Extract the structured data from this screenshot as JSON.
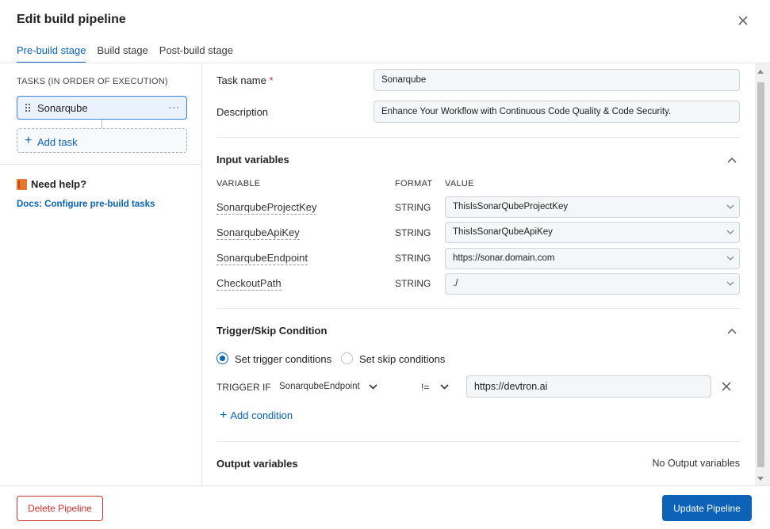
{
  "modal": {
    "title": "Edit build pipeline"
  },
  "tabs": [
    {
      "label": "Pre-build stage",
      "active": true
    },
    {
      "label": "Build stage",
      "active": false
    },
    {
      "label": "Post-build stage",
      "active": false
    }
  ],
  "sidebar": {
    "heading": "TASKS (IN ORDER OF EXECUTION)",
    "tasks": [
      {
        "name": "Sonarqube"
      }
    ],
    "more_glyph": "···",
    "add_task_label": "Add task",
    "help_title": "Need help?",
    "docs_link": "Docs: Configure pre-build tasks"
  },
  "task": {
    "name_label": "Task name",
    "required_mark": "*",
    "name_value": "Sonarqube",
    "description_label": "Description",
    "description_value": "Enhance Your Workflow with Continuous Code Quality & Code Security."
  },
  "input_variables": {
    "title": "Input variables",
    "headers": {
      "variable": "VARIABLE",
      "format": "FORMAT",
      "value": "VALUE"
    },
    "rows": [
      {
        "name": "SonarqubeProjectKey",
        "format": "STRING",
        "value": "ThisIsSonarQubeProjectKey"
      },
      {
        "name": "SonarqubeApiKey",
        "format": "STRING",
        "value": "ThisIsSonarQubeApiKey"
      },
      {
        "name": "SonarqubeEndpoint",
        "format": "STRING",
        "value": "https://sonar.domain.com"
      },
      {
        "name": "CheckoutPath",
        "format": "STRING",
        "value": "./"
      }
    ]
  },
  "condition": {
    "title": "Trigger/Skip Condition",
    "options": [
      {
        "label": "Set trigger conditions",
        "selected": true
      },
      {
        "label": "Set skip conditions",
        "selected": false
      }
    ],
    "trigger_label": "TRIGGER IF",
    "variable": "SonarqubeEndpoint",
    "operator": "!=",
    "value": "https://devtron.ai",
    "add_condition_label": "Add condition"
  },
  "output_variables": {
    "title": "Output variables",
    "empty_text": "No Output variables"
  },
  "footer": {
    "delete_label": "Delete Pipeline",
    "update_label": "Update Pipeline"
  },
  "colors": {
    "accent": "#0b62b6",
    "danger": "#d0312d",
    "selected_task_bg": "#eaf2fd"
  }
}
